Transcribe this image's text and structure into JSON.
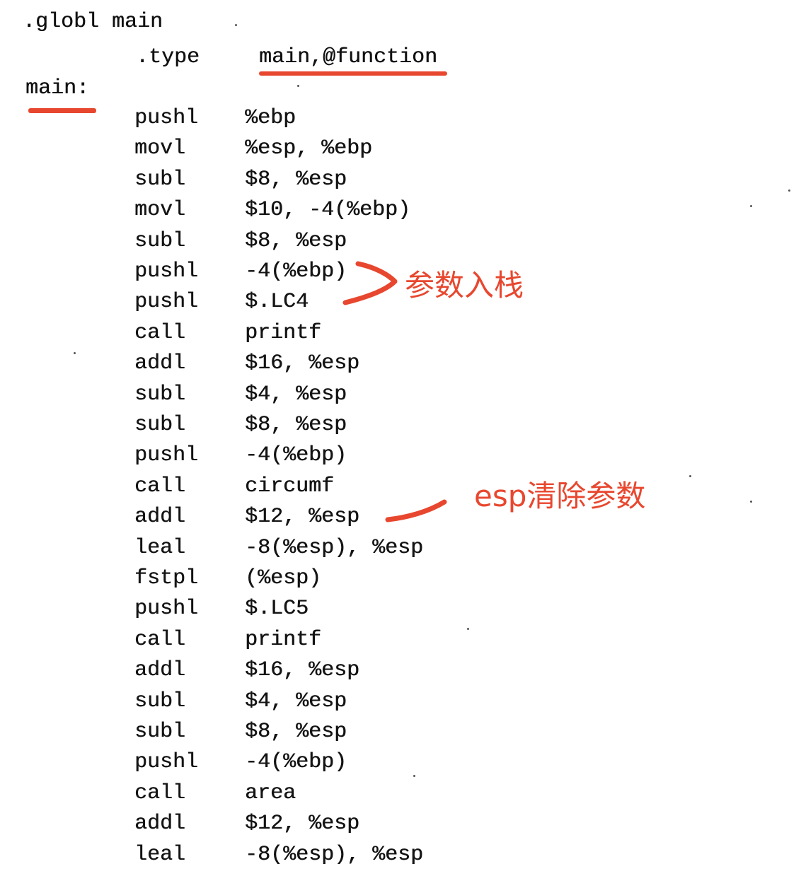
{
  "header": {
    "globl": ".globl main",
    "directive_op": ".type",
    "directive_arg": "main,@function",
    "label": "main:"
  },
  "instructions": [
    {
      "op": "pushl",
      "arg": "%ebp"
    },
    {
      "op": "movl",
      "arg": "%esp, %ebp"
    },
    {
      "op": "subl",
      "arg": "$8, %esp"
    },
    {
      "op": "movl",
      "arg": "$10, -4(%ebp)"
    },
    {
      "op": "subl",
      "arg": "$8, %esp"
    },
    {
      "op": "pushl",
      "arg": "-4(%ebp)"
    },
    {
      "op": "pushl",
      "arg": "$.LC4"
    },
    {
      "op": "call",
      "arg": "printf"
    },
    {
      "op": "addl",
      "arg": "$16, %esp"
    },
    {
      "op": "subl",
      "arg": "$4, %esp"
    },
    {
      "op": "subl",
      "arg": "$8, %esp"
    },
    {
      "op": "pushl",
      "arg": "-4(%ebp)"
    },
    {
      "op": "call",
      "arg": "circumf"
    },
    {
      "op": "addl",
      "arg": "$12, %esp"
    },
    {
      "op": "leal",
      "arg": "-8(%esp), %esp"
    },
    {
      "op": "fstpl",
      "arg": "(%esp)"
    },
    {
      "op": "pushl",
      "arg": "$.LC5"
    },
    {
      "op": "call",
      "arg": "printf"
    },
    {
      "op": "addl",
      "arg": "$16, %esp"
    },
    {
      "op": "subl",
      "arg": "$4, %esp"
    },
    {
      "op": "subl",
      "arg": "$8, %esp"
    },
    {
      "op": "pushl",
      "arg": "-4(%ebp)"
    },
    {
      "op": "call",
      "arg": "area"
    },
    {
      "op": "addl",
      "arg": "$12, %esp"
    },
    {
      "op": "leal",
      "arg": "-8(%esp), %esp"
    }
  ],
  "annotations": {
    "stack_push": "参数入栈",
    "esp_clear": "esp清除参数"
  },
  "colors": {
    "annotation": "#e8472f",
    "code": "#111111",
    "background": "#ffffff"
  }
}
